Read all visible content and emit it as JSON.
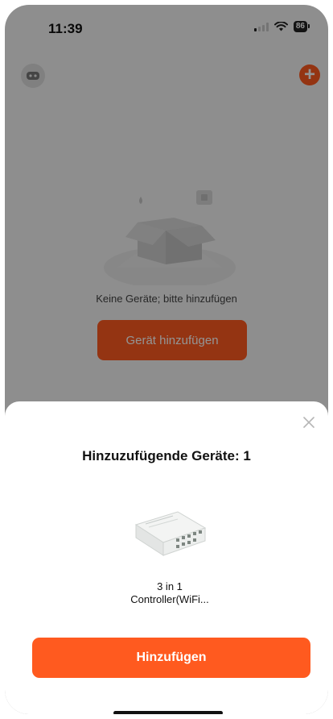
{
  "status_bar": {
    "time": "11:39",
    "battery": "86"
  },
  "header": {
    "add_icon": "plus-icon",
    "avatar_icon": "robot-avatar-icon"
  },
  "empty_state": {
    "message": "Keine Geräte; bitte hinzufügen",
    "add_button_label": "Gerät hinzufügen"
  },
  "sheet": {
    "title": "Hinzuzufügende Geräte: 1",
    "device": {
      "name_line1": "3 in 1",
      "name_line2": "Controller(WiFi..."
    },
    "add_button_label": "Hinzufügen"
  },
  "colors": {
    "accent": "#ff5a1f",
    "background": "#f4f4f4"
  }
}
